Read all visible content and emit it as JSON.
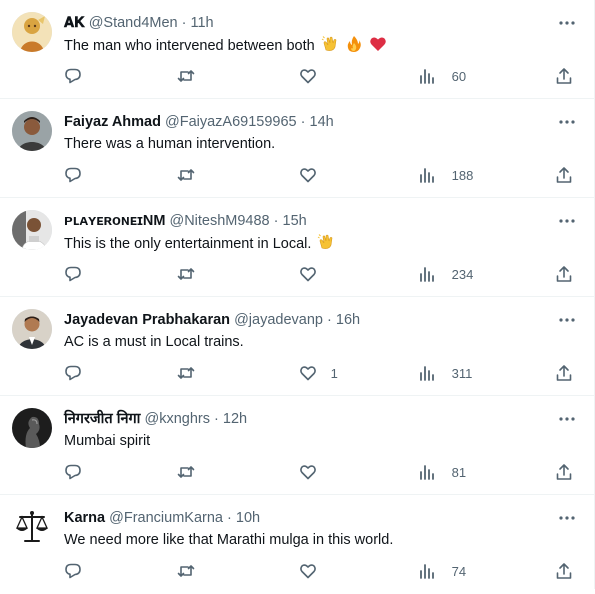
{
  "replies": [
    {
      "name": "𝐀𝐊",
      "handle": "@Stand4Men",
      "dot": "·",
      "time": "11h",
      "text": "The man who intervened between both",
      "emojis": [
        "clapping-hands-icon",
        "fire-icon",
        "red-heart-icon"
      ],
      "likes": "",
      "views": "60",
      "avatar": "hanuman-illustration"
    },
    {
      "name": "Faiyaz Ahmad",
      "handle": "@FaiyazA69159965",
      "dot": "·",
      "time": "14h",
      "text": "There was a human intervention.",
      "emojis": [],
      "likes": "",
      "views": "188",
      "avatar": "man-photo"
    },
    {
      "name": "ᴘʟᴀʏᴇʀᴏɴᴇɪNM",
      "handle": "@NiteshM9488",
      "dot": "·",
      "time": "15h",
      "text": "This is the only entertainment in Local.",
      "emojis": [
        "clapping-hands-icon"
      ],
      "likes": "",
      "views": "234",
      "avatar": "man-dark-photo"
    },
    {
      "name": "Jayadevan Prabhakaran",
      "handle": "@jayadevanp",
      "dot": "·",
      "time": "16h",
      "text": "AC is a must in Local trains.",
      "emojis": [],
      "likes": "1",
      "views": "311",
      "avatar": "man-suit-photo"
    },
    {
      "name": "निगरजीत निगा",
      "handle": "@kxnghrs",
      "dot": "·",
      "time": "12h",
      "text": "Mumbai spirit",
      "emojis": [],
      "likes": "",
      "views": "81",
      "avatar": "profile-silhouette-photo"
    },
    {
      "name": "Karna",
      "handle": "@FranciumKarna",
      "dot": "·",
      "time": "10h",
      "text": "We need more like that Marathi mulga in this world.",
      "emojis": [],
      "likes": "",
      "views": "74",
      "avatar": "scales-of-justice-icon"
    }
  ],
  "colors": {
    "text": "#0f1419",
    "secondary": "#536471",
    "border": "#eff3f4"
  }
}
